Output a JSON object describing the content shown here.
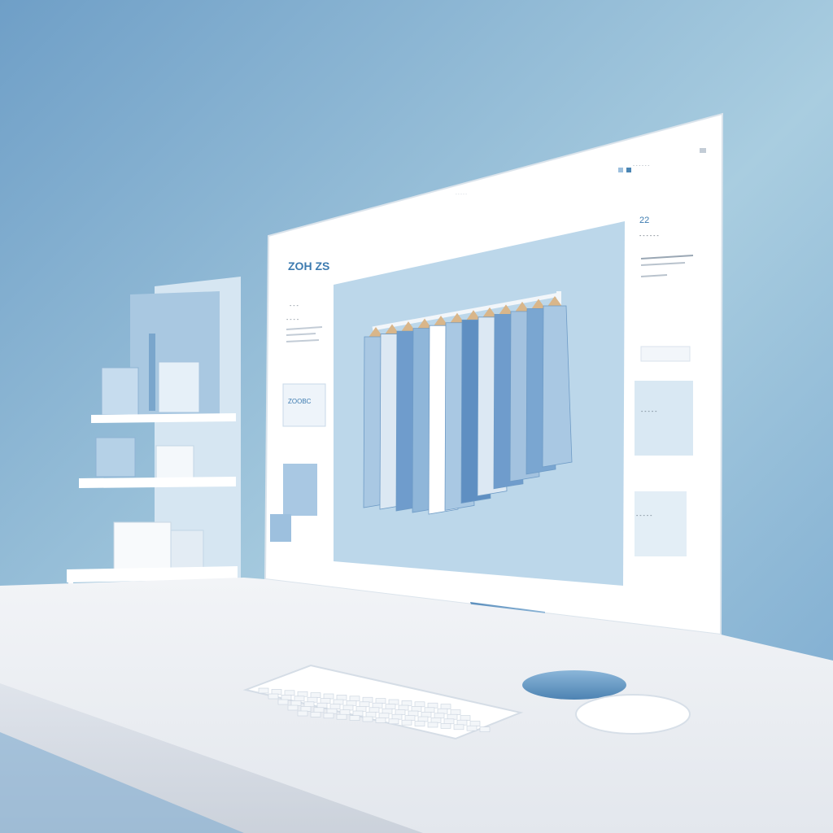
{
  "palette": {
    "wall_light": "#b7d3e2",
    "wall_dark": "#6f9fc7",
    "desk_top": "#eef1f5",
    "desk_front": "#d9dee6",
    "screen_bg": "#ffffff",
    "hero_bg": "#bcd7ea",
    "accent_blue": "#4b86b4",
    "garment_light": "#dce8f3",
    "garment_mid": "#a9c8e3",
    "garment_dark": "#6f9ccc",
    "hanger_wood": "#d9b68a",
    "logo_blue": "#3d7bb0"
  },
  "screen": {
    "logo": "ZOH ZS",
    "nav_top": "- - - - - -",
    "header_line": "- - - - -",
    "left_label_1": "- - -",
    "left_label_2": "- - - -",
    "left_card_text": "ZOOBC",
    "right_number": "22",
    "right_title": "- - - - - -",
    "right_card_1_text": "- - - - -",
    "right_card_2_text": "- - - - -"
  },
  "icons": {
    "clothing_rack": "clothing-rack-icon",
    "keyboard": "keyboard-icon",
    "mouse": "mouse-icon",
    "shelf": "shelf-icon"
  }
}
